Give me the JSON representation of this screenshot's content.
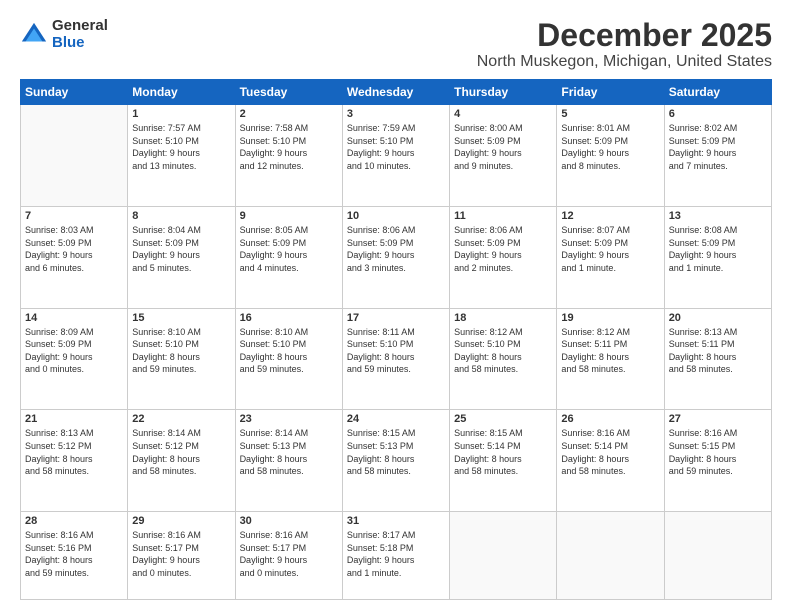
{
  "logo": {
    "general": "General",
    "blue": "Blue"
  },
  "header": {
    "month": "December 2025",
    "location": "North Muskegon, Michigan, United States"
  },
  "weekdays": [
    "Sunday",
    "Monday",
    "Tuesday",
    "Wednesday",
    "Thursday",
    "Friday",
    "Saturday"
  ],
  "weeks": [
    [
      {
        "day": "",
        "info": ""
      },
      {
        "day": "1",
        "info": "Sunrise: 7:57 AM\nSunset: 5:10 PM\nDaylight: 9 hours\nand 13 minutes."
      },
      {
        "day": "2",
        "info": "Sunrise: 7:58 AM\nSunset: 5:10 PM\nDaylight: 9 hours\nand 12 minutes."
      },
      {
        "day": "3",
        "info": "Sunrise: 7:59 AM\nSunset: 5:10 PM\nDaylight: 9 hours\nand 10 minutes."
      },
      {
        "day": "4",
        "info": "Sunrise: 8:00 AM\nSunset: 5:09 PM\nDaylight: 9 hours\nand 9 minutes."
      },
      {
        "day": "5",
        "info": "Sunrise: 8:01 AM\nSunset: 5:09 PM\nDaylight: 9 hours\nand 8 minutes."
      },
      {
        "day": "6",
        "info": "Sunrise: 8:02 AM\nSunset: 5:09 PM\nDaylight: 9 hours\nand 7 minutes."
      }
    ],
    [
      {
        "day": "7",
        "info": "Sunrise: 8:03 AM\nSunset: 5:09 PM\nDaylight: 9 hours\nand 6 minutes."
      },
      {
        "day": "8",
        "info": "Sunrise: 8:04 AM\nSunset: 5:09 PM\nDaylight: 9 hours\nand 5 minutes."
      },
      {
        "day": "9",
        "info": "Sunrise: 8:05 AM\nSunset: 5:09 PM\nDaylight: 9 hours\nand 4 minutes."
      },
      {
        "day": "10",
        "info": "Sunrise: 8:06 AM\nSunset: 5:09 PM\nDaylight: 9 hours\nand 3 minutes."
      },
      {
        "day": "11",
        "info": "Sunrise: 8:06 AM\nSunset: 5:09 PM\nDaylight: 9 hours\nand 2 minutes."
      },
      {
        "day": "12",
        "info": "Sunrise: 8:07 AM\nSunset: 5:09 PM\nDaylight: 9 hours\nand 1 minute."
      },
      {
        "day": "13",
        "info": "Sunrise: 8:08 AM\nSunset: 5:09 PM\nDaylight: 9 hours\nand 1 minute."
      }
    ],
    [
      {
        "day": "14",
        "info": "Sunrise: 8:09 AM\nSunset: 5:09 PM\nDaylight: 9 hours\nand 0 minutes."
      },
      {
        "day": "15",
        "info": "Sunrise: 8:10 AM\nSunset: 5:10 PM\nDaylight: 8 hours\nand 59 minutes."
      },
      {
        "day": "16",
        "info": "Sunrise: 8:10 AM\nSunset: 5:10 PM\nDaylight: 8 hours\nand 59 minutes."
      },
      {
        "day": "17",
        "info": "Sunrise: 8:11 AM\nSunset: 5:10 PM\nDaylight: 8 hours\nand 59 minutes."
      },
      {
        "day": "18",
        "info": "Sunrise: 8:12 AM\nSunset: 5:10 PM\nDaylight: 8 hours\nand 58 minutes."
      },
      {
        "day": "19",
        "info": "Sunrise: 8:12 AM\nSunset: 5:11 PM\nDaylight: 8 hours\nand 58 minutes."
      },
      {
        "day": "20",
        "info": "Sunrise: 8:13 AM\nSunset: 5:11 PM\nDaylight: 8 hours\nand 58 minutes."
      }
    ],
    [
      {
        "day": "21",
        "info": "Sunrise: 8:13 AM\nSunset: 5:12 PM\nDaylight: 8 hours\nand 58 minutes."
      },
      {
        "day": "22",
        "info": "Sunrise: 8:14 AM\nSunset: 5:12 PM\nDaylight: 8 hours\nand 58 minutes."
      },
      {
        "day": "23",
        "info": "Sunrise: 8:14 AM\nSunset: 5:13 PM\nDaylight: 8 hours\nand 58 minutes."
      },
      {
        "day": "24",
        "info": "Sunrise: 8:15 AM\nSunset: 5:13 PM\nDaylight: 8 hours\nand 58 minutes."
      },
      {
        "day": "25",
        "info": "Sunrise: 8:15 AM\nSunset: 5:14 PM\nDaylight: 8 hours\nand 58 minutes."
      },
      {
        "day": "26",
        "info": "Sunrise: 8:16 AM\nSunset: 5:14 PM\nDaylight: 8 hours\nand 58 minutes."
      },
      {
        "day": "27",
        "info": "Sunrise: 8:16 AM\nSunset: 5:15 PM\nDaylight: 8 hours\nand 59 minutes."
      }
    ],
    [
      {
        "day": "28",
        "info": "Sunrise: 8:16 AM\nSunset: 5:16 PM\nDaylight: 8 hours\nand 59 minutes."
      },
      {
        "day": "29",
        "info": "Sunrise: 8:16 AM\nSunset: 5:17 PM\nDaylight: 9 hours\nand 0 minutes."
      },
      {
        "day": "30",
        "info": "Sunrise: 8:16 AM\nSunset: 5:17 PM\nDaylight: 9 hours\nand 0 minutes."
      },
      {
        "day": "31",
        "info": "Sunrise: 8:17 AM\nSunset: 5:18 PM\nDaylight: 9 hours\nand 1 minute."
      },
      {
        "day": "",
        "info": ""
      },
      {
        "day": "",
        "info": ""
      },
      {
        "day": "",
        "info": ""
      }
    ]
  ]
}
